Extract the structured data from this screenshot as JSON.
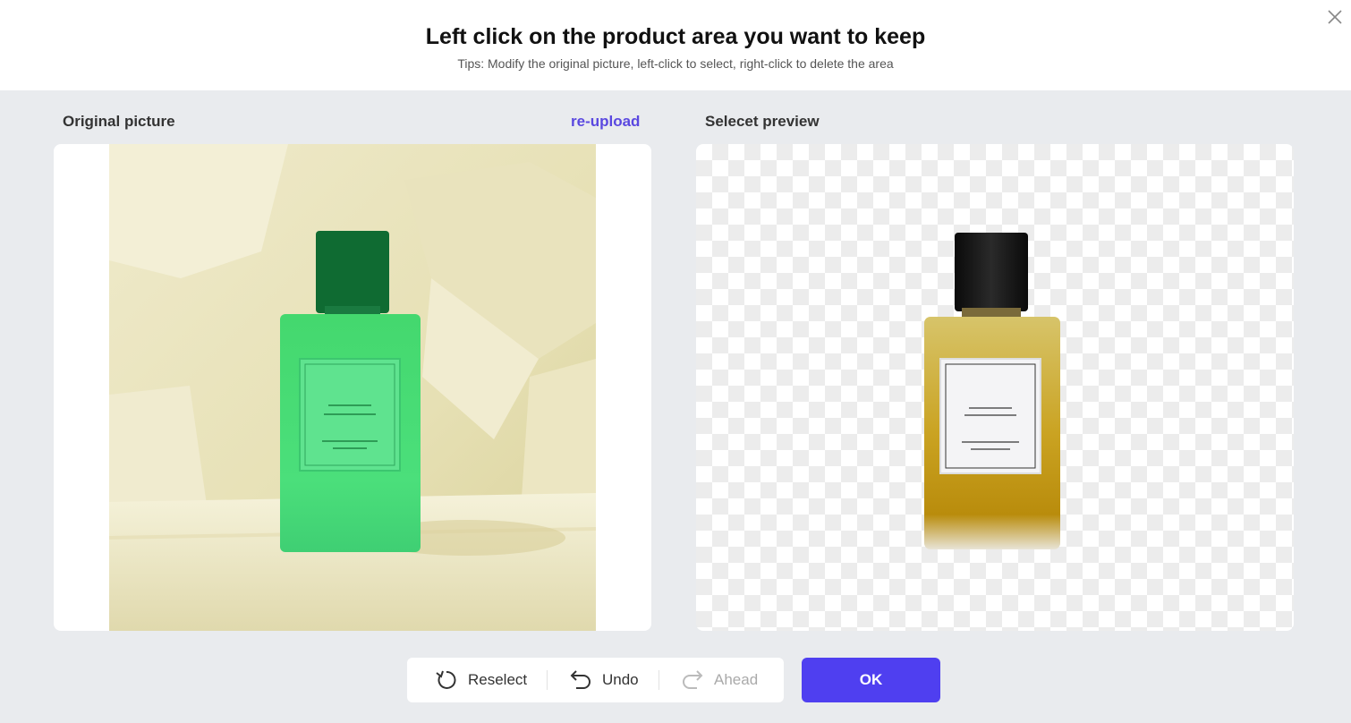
{
  "header": {
    "title": "Left click on the product area you want to keep",
    "tips": "Tips: Modify the original picture, left-click to select, right-click to delete the area"
  },
  "original": {
    "label": "Original picture",
    "reupload_label": "re-upload"
  },
  "preview": {
    "label": "Selecet preview"
  },
  "toolbar": {
    "reselect_label": "Reselect",
    "undo_label": "Undo",
    "ahead_label": "Ahead"
  },
  "ok_label": "OK",
  "colors": {
    "accent": "#4f3ff0",
    "link": "#5a48e0",
    "selection_mask": "#3ee07a"
  }
}
